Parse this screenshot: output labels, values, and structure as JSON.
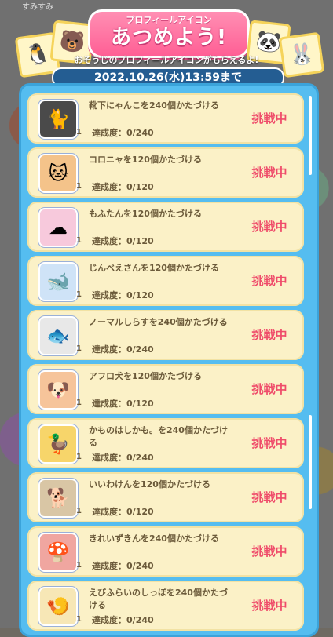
{
  "header": {
    "title_sub": "プロフィールアイコン",
    "title_main": "あつめよう!",
    "subtitle": "おそうじのプロフィールアイコンがもらえるよ!",
    "deadline": "2022.10.26(水)13:59まで",
    "top_hint": "すみすみ"
  },
  "missions": [
    {
      "text": "靴下にゃんこを240個かたづける",
      "progress": "達成度：0/240",
      "qty": "1",
      "status": "挑戦中",
      "icon": "sock-cat-icon"
    },
    {
      "text": "コロニャを120個かたづける",
      "progress": "達成度：0/120",
      "qty": "1",
      "status": "挑戦中",
      "icon": "koronya-icon"
    },
    {
      "text": "もふたんを120個かたづける",
      "progress": "達成度：0/120",
      "qty": "1",
      "status": "挑戦中",
      "icon": "mofutan-icon"
    },
    {
      "text": "じんべえさんを120個かたづける",
      "progress": "達成度：0/120",
      "qty": "1",
      "status": "挑戦中",
      "icon": "jinbe-icon"
    },
    {
      "text": "ノーマルしらすを240個かたづける",
      "progress": "達成度：0/240",
      "qty": "1",
      "status": "挑戦中",
      "icon": "shirasu-icon"
    },
    {
      "text": "アフロ犬を120個かたづける",
      "progress": "達成度：0/120",
      "qty": "1",
      "status": "挑戦中",
      "icon": "afro-dog-icon"
    },
    {
      "text": "かものはしかも。を240個かたづける",
      "progress": "達成度：0/240",
      "qty": "1",
      "status": "挑戦中",
      "icon": "kamonohashikamo-icon"
    },
    {
      "text": "いいわけんを120個かたづける",
      "progress": "達成度：0/120",
      "qty": "1",
      "status": "挑戦中",
      "icon": "iiwaken-icon"
    },
    {
      "text": "きれいずきんを240個かたづける",
      "progress": "達成度：0/240",
      "qty": "1",
      "status": "挑戦中",
      "icon": "kireizukin-icon"
    },
    {
      "text": "えびふらいのしっぽを240個かたづける",
      "progress": "達成度：0/240",
      "qty": "1",
      "status": "挑戦中",
      "icon": "ebi-fry-tail-icon"
    }
  ],
  "colors": {
    "accent": "#ff5f95",
    "panel": "#55bdf0",
    "status": "#ef4c6a"
  }
}
